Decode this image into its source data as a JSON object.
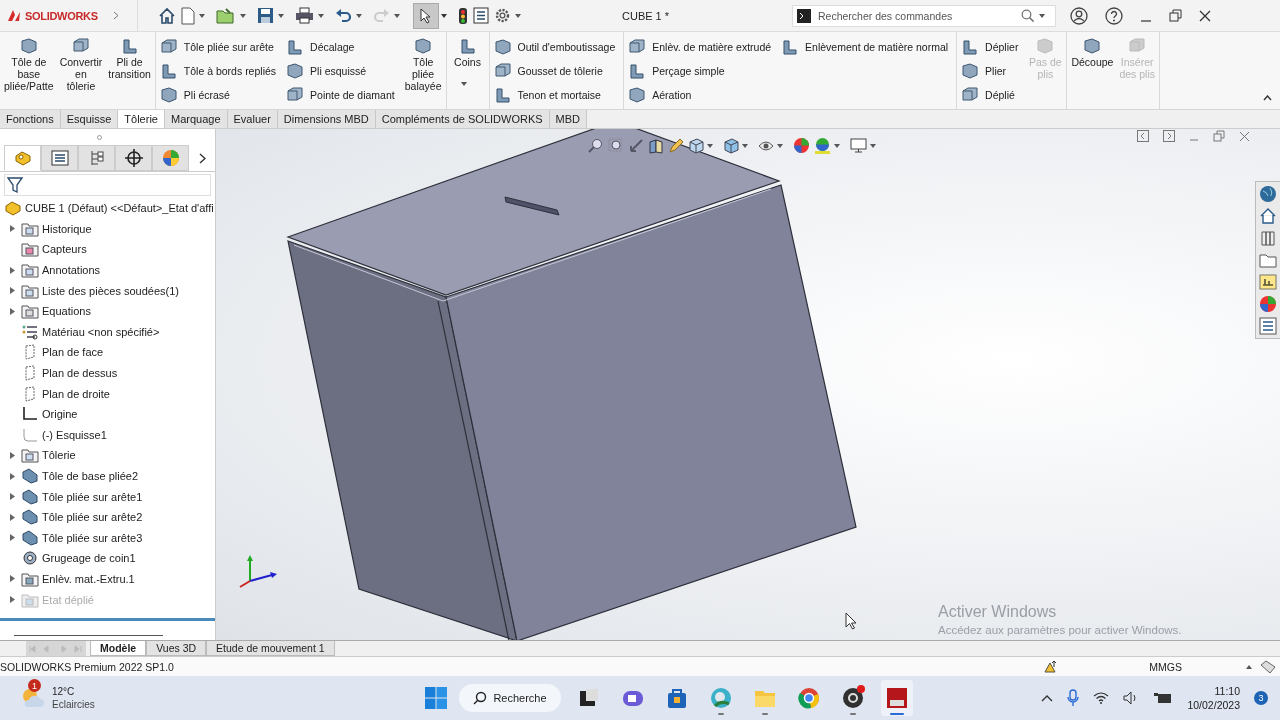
{
  "title_bar": {
    "app_name": "SOLIDWORKS",
    "document_title": "CUBE 1 *",
    "search": {
      "placeholder": "Rechercher des commandes"
    }
  },
  "ribbon": {
    "groups": [
      {
        "columns": [
          [
            {
              "kind": "large",
              "label": "Tôle de\nbase\npliée/Patte",
              "disabled": false
            }
          ],
          [
            {
              "kind": "large",
              "label": "Convertir\nen\ntôlerie",
              "disabled": false
            }
          ],
          [
            {
              "kind": "large",
              "label": "Pli de\ntransition",
              "disabled": false
            }
          ]
        ]
      },
      {
        "columns": [
          [
            {
              "kind": "small",
              "label": "Tôle pliée sur arête",
              "disabled": false
            },
            {
              "kind": "small",
              "label": "Tôle à bords repliés",
              "disabled": false
            },
            {
              "kind": "small",
              "label": "Pli écrasé",
              "disabled": false
            }
          ],
          [
            {
              "kind": "small",
              "label": "Décalage",
              "disabled": false
            },
            {
              "kind": "small",
              "label": "Pli esquissé",
              "disabled": false
            },
            {
              "kind": "small",
              "label": "Pointe de diamant",
              "disabled": false
            }
          ],
          [
            {
              "kind": "large",
              "label": "Tôle\npliée\nbalayée",
              "disabled": false
            }
          ]
        ]
      },
      {
        "columns": [
          [
            {
              "kind": "large_menu",
              "label": "Coins",
              "disabled": false
            }
          ]
        ]
      },
      {
        "columns": [
          [
            {
              "kind": "small",
              "label": "Outil d'emboutissage",
              "disabled": false
            },
            {
              "kind": "small",
              "label": "Gousset de tôlerie",
              "disabled": false
            },
            {
              "kind": "small",
              "label": "Tenon et mortaise",
              "disabled": false
            }
          ]
        ]
      },
      {
        "columns": [
          [
            {
              "kind": "small",
              "label": "Enlèv. de matière extrudé",
              "disabled": false
            },
            {
              "kind": "small",
              "label": "Perçage simple",
              "disabled": false
            },
            {
              "kind": "small",
              "label": "Aération",
              "disabled": false
            }
          ],
          [
            {
              "kind": "small",
              "label": "Enlèvement de matière normal",
              "disabled": false
            }
          ]
        ]
      },
      {
        "columns": [
          [
            {
              "kind": "small",
              "label": "Déplier",
              "disabled": false
            },
            {
              "kind": "small",
              "label": "Plier",
              "disabled": false
            },
            {
              "kind": "small",
              "label": "Déplié",
              "disabled": false
            }
          ],
          [
            {
              "kind": "large",
              "label": "Pas de\nplis",
              "disabled": true
            }
          ]
        ]
      },
      {
        "columns": [
          [
            {
              "kind": "large",
              "label": "Découpe",
              "disabled": false
            }
          ],
          [
            {
              "kind": "large",
              "label": "Insérer\ndes plis",
              "disabled": true
            }
          ]
        ]
      }
    ]
  },
  "command_tabs": [
    {
      "label": "Fonctions",
      "selected": false
    },
    {
      "label": "Esquisse",
      "selected": false
    },
    {
      "label": "Tôlerie",
      "selected": true
    },
    {
      "label": "Marquage",
      "selected": false
    },
    {
      "label": "Evaluer",
      "selected": false
    },
    {
      "label": "Dimensions MBD",
      "selected": false
    },
    {
      "label": "Compléments de SOLIDWORKS",
      "selected": false
    },
    {
      "label": "MBD",
      "selected": false
    }
  ],
  "manager_tabs": [
    {
      "selected": true
    },
    {
      "selected": false
    },
    {
      "selected": false
    },
    {
      "selected": false
    },
    {
      "selected": false
    }
  ],
  "feature_tree": {
    "label": "CUBE 1 (Défaut) <<Défaut>_Etat d'affi",
    "children": [
      {
        "label": "Historique",
        "expandable": true,
        "disabled": false
      },
      {
        "label": "Capteurs",
        "expandable": false,
        "disabled": false
      },
      {
        "label": "Annotations",
        "expandable": true,
        "disabled": false
      },
      {
        "label": "Liste des pièces soudées(1)",
        "expandable": true,
        "disabled": false
      },
      {
        "label": "Equations",
        "expandable": true,
        "disabled": false
      },
      {
        "label": "Matériau <non spécifié>",
        "expandable": false,
        "disabled": false
      },
      {
        "label": "Plan de face",
        "expandable": false,
        "disabled": false
      },
      {
        "label": "Plan de dessus",
        "expandable": false,
        "disabled": false
      },
      {
        "label": "Plan de droite",
        "expandable": false,
        "disabled": false
      },
      {
        "label": "Origine",
        "expandable": false,
        "disabled": false
      },
      {
        "label": "(-) Esquisse1",
        "expandable": false,
        "disabled": false
      },
      {
        "label": "Tôlerie",
        "expandable": true,
        "disabled": false
      },
      {
        "label": "Tôle de base pliée2",
        "expandable": true,
        "disabled": false
      },
      {
        "label": "Tôle pliée sur arête1",
        "expandable": true,
        "disabled": false
      },
      {
        "label": "Tôle pliée sur arête2",
        "expandable": true,
        "disabled": false
      },
      {
        "label": "Tôle pliée sur arête3",
        "expandable": true,
        "disabled": false
      },
      {
        "label": "Grugeage de coin1",
        "expandable": false,
        "disabled": false
      },
      {
        "label": "Enlèv. mat.-Extru.1",
        "expandable": true,
        "disabled": false
      },
      {
        "label": "Etat déplié",
        "expandable": true,
        "disabled": true
      }
    ]
  },
  "model_tabs": [
    {
      "label": "Modèle",
      "selected": true
    },
    {
      "label": "Vues 3D",
      "selected": false
    },
    {
      "label": "Etude de mouvement 1",
      "selected": false
    }
  ],
  "windows_notice": {
    "title": "Activer Windows",
    "message": "Accédez aux paramètres pour activer Windows."
  },
  "status_bar": {
    "product": "SOLIDWORKS Premium 2022 SP1.0",
    "units": "MMGS"
  },
  "taskbar": {
    "weather": {
      "badge": "1",
      "temperature": "12°C",
      "condition": "Eclaircies"
    },
    "search_label": "Recherche",
    "apps": [
      {
        "running": false,
        "active": false,
        "alert": false
      },
      {
        "running": false,
        "active": false,
        "alert": false
      },
      {
        "running": false,
        "active": false,
        "alert": false
      },
      {
        "running": true,
        "active": false,
        "alert": false
      },
      {
        "running": true,
        "active": false,
        "alert": false
      },
      {
        "running": false,
        "active": false,
        "alert": false
      },
      {
        "running": true,
        "active": false,
        "alert": true
      },
      {
        "running": true,
        "active": true,
        "alert": false
      }
    ],
    "time": "11:10",
    "date": "10/02/2023",
    "notifications": "3"
  }
}
